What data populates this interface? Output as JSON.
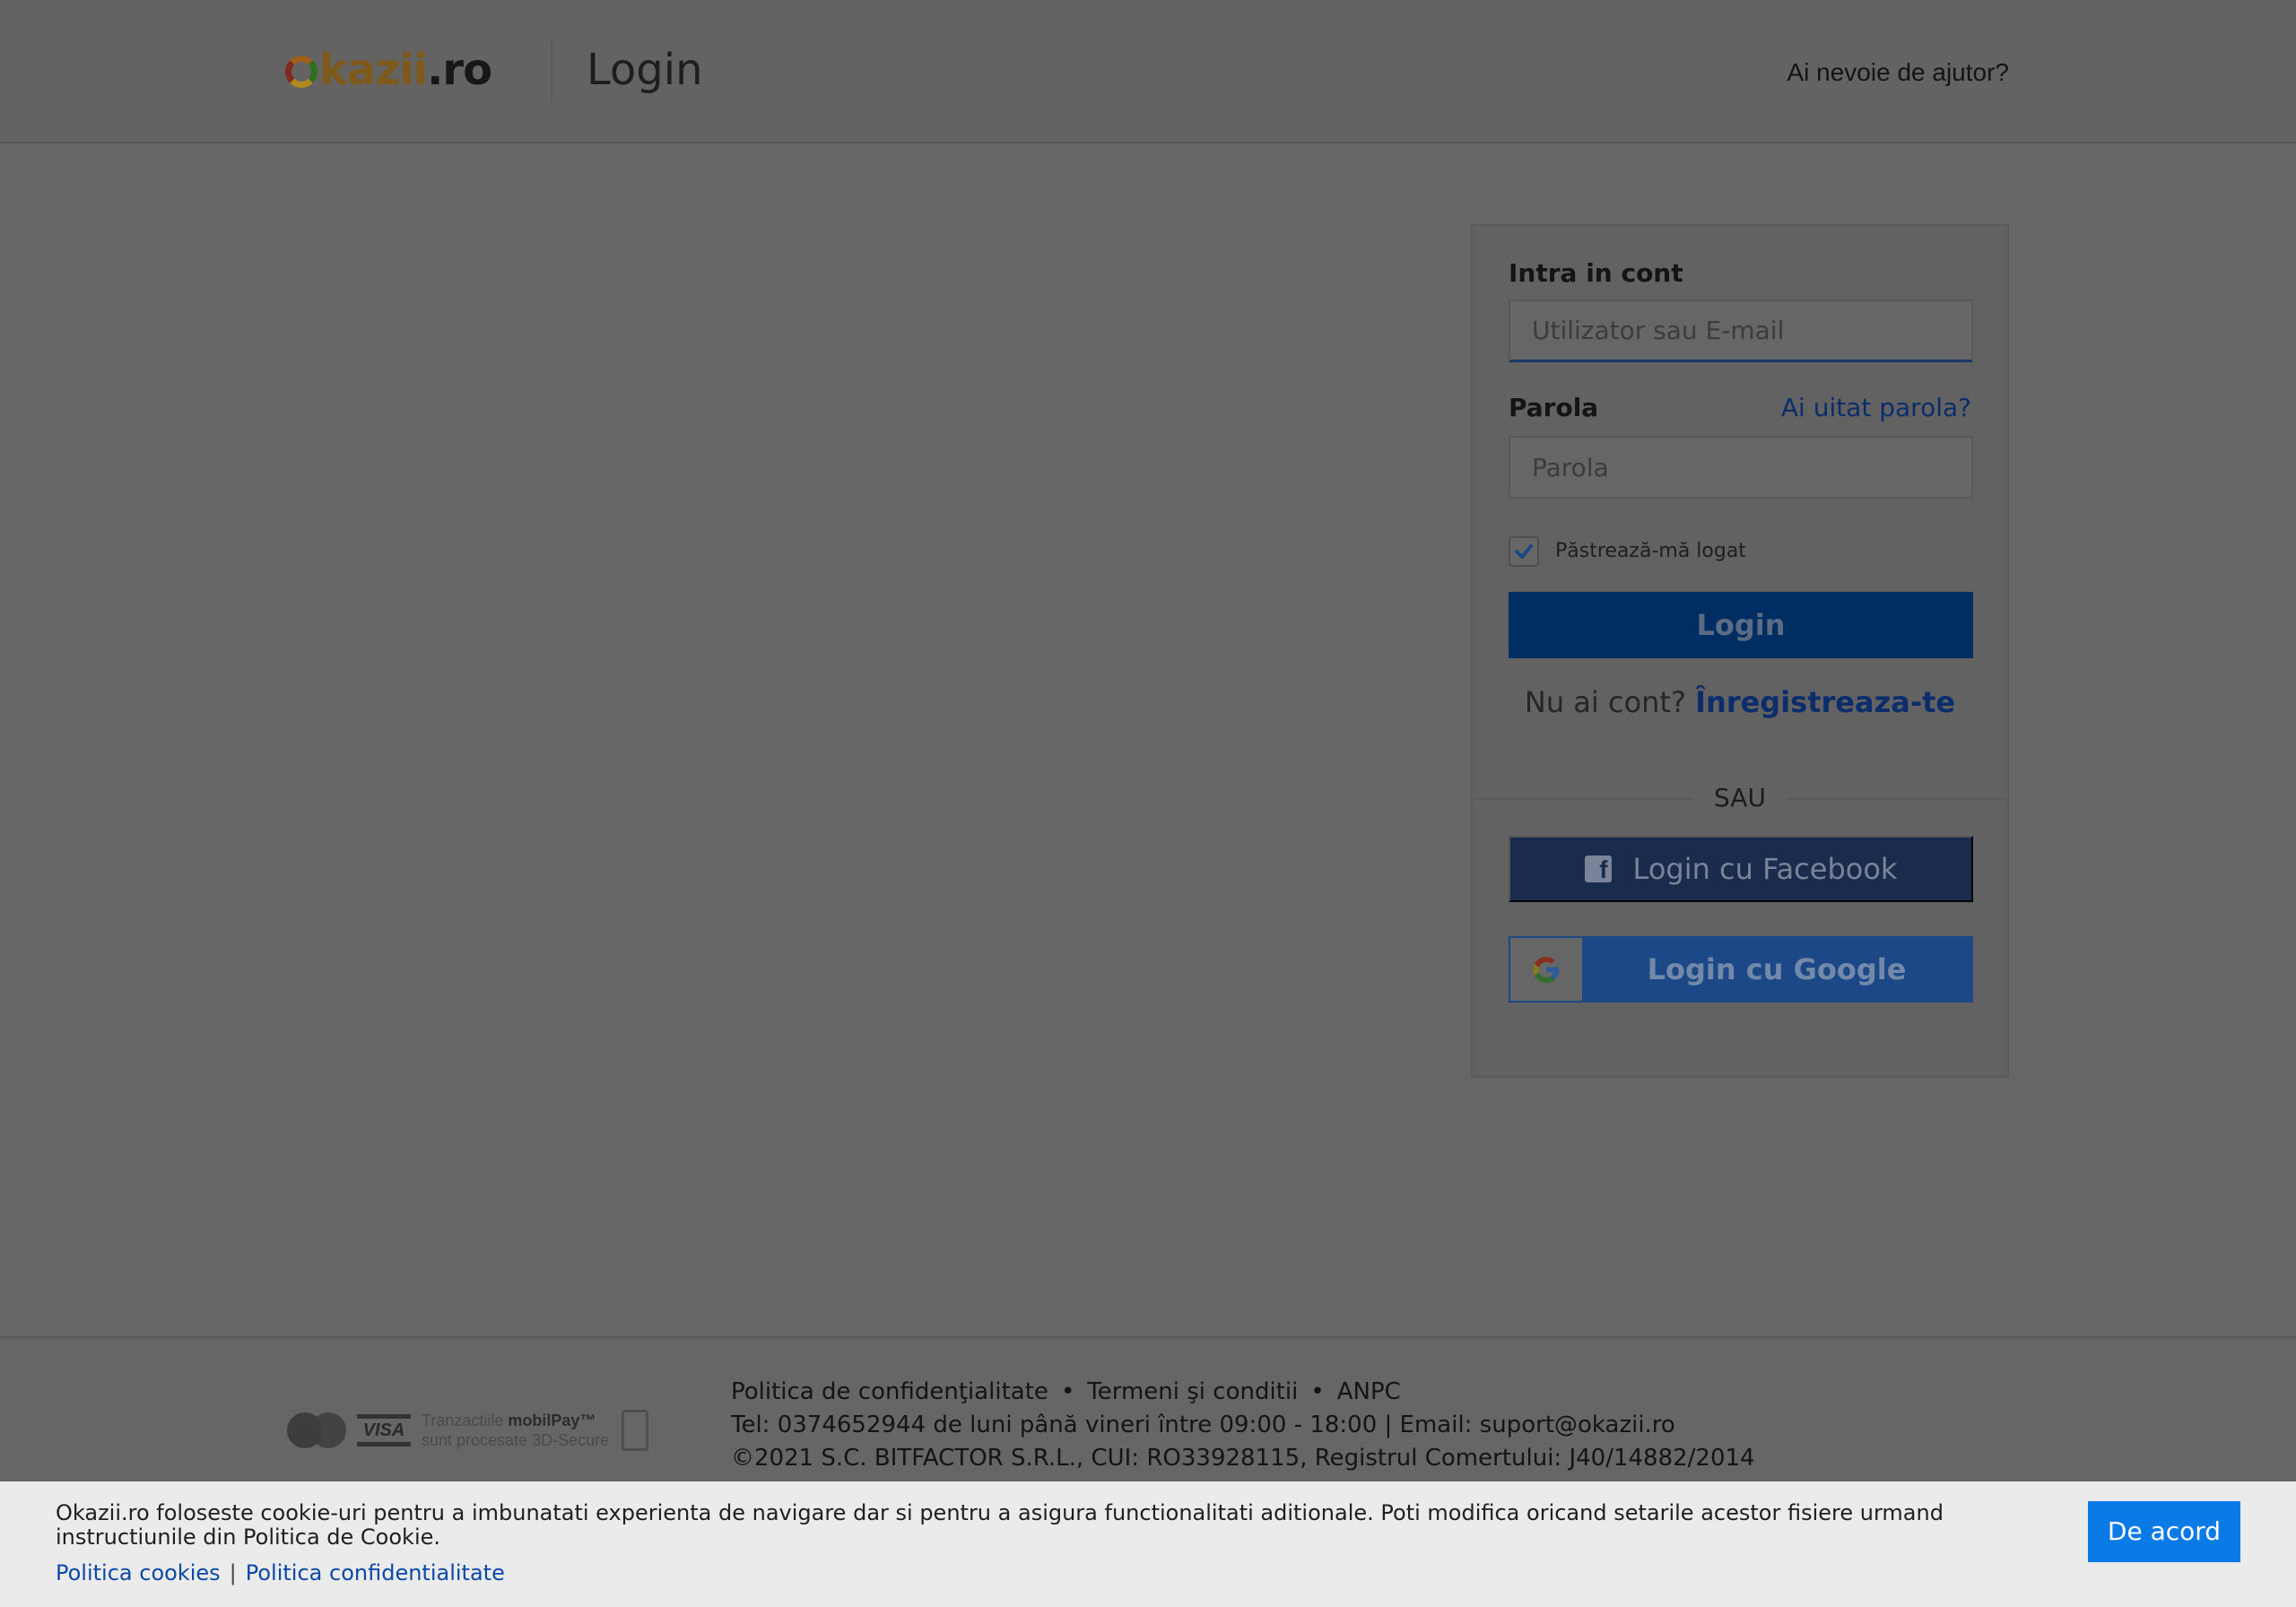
{
  "header": {
    "logo_main": "kazii",
    "logo_tld": ".ro",
    "title": "Login",
    "help_link": "Ai nevoie de ajutor?"
  },
  "login": {
    "heading": "Intra in cont",
    "user_placeholder": "Utilizator sau E-mail",
    "password_label": "Parola",
    "forgot_link": "Ai uitat parola?",
    "password_placeholder": "Parola",
    "remember_label": "Păstrează-mă logat",
    "remember_checked": true,
    "login_button": "Login",
    "no_account_text": "Nu ai cont?",
    "register_link": "Înregistreaza-te",
    "separator": "SAU",
    "facebook_button": "Login cu Facebook",
    "google_button": "Login cu Google"
  },
  "footer": {
    "payment_text_1": "Tranzactiile",
    "payment_brand": "mobilPay™",
    "payment_text_2": "sunt procesate 3D-Secure",
    "visa_label": "VISA",
    "privacy_link": "Politica de confidenţialitate",
    "terms_link": "Termeni şi conditii",
    "anpc_link": "ANPC",
    "contact_line": "Tel: 0374652944 de luni până vineri între 09:00 - 18:00 | Email: suport@okazii.ro",
    "copyright_line": "©2021 S.C. BITFACTOR S.R.L., CUI: RO33928115, Registrul Comertului: J40/14882/2014"
  },
  "cookie_banner": {
    "text": "Okazii.ro foloseste cookie-uri pentru a imbunatati experienta de navigare dar si pentru a asigura functionalitati aditionale. Poti modifica oricand setarile acestor fisiere urmand instructiunile din Politica de Cookie.",
    "cookies_link": "Politica cookies",
    "separator": "|",
    "privacy_link": "Politica confidentialitate",
    "agree_button": "De acord"
  },
  "colors": {
    "overlay_background": "#666666",
    "login_button": "#002d62",
    "facebook_button": "#1a2c4e",
    "google_button": "#1d4887",
    "agree_button": "#0a7be6",
    "link": "#0b2d6b"
  },
  "icons": [
    "okazii-logo-ring-icon",
    "check-icon",
    "facebook-icon",
    "google-icon",
    "mastercard-icon",
    "visa-icon",
    "lock-icon"
  ]
}
